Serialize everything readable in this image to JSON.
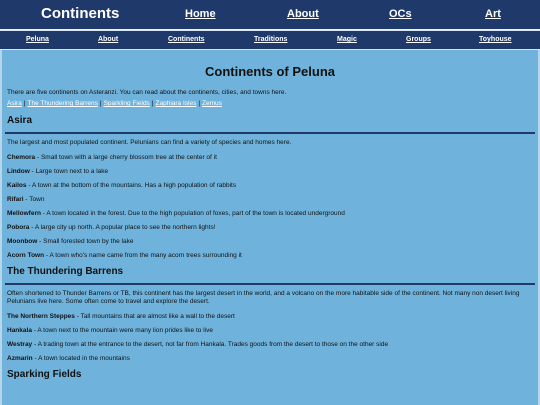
{
  "header": {
    "site_title": "Continents",
    "nav": [
      "Home",
      "About",
      "OCs",
      "Art"
    ]
  },
  "subnav": [
    "Peluna",
    "About",
    "Continents",
    "Traditions",
    "Magic",
    "Groups",
    "Toyhouse"
  ],
  "page": {
    "title": "Continents of Peluna",
    "intro": "There are five continents on Asteranzi. You can read about the continents, cities, and towns here.",
    "quicklinks": [
      "Asira",
      "The Thundering Barrens",
      "Sparkling Fields",
      "Zaphiara Isles",
      "Zemus"
    ]
  },
  "sections": [
    {
      "title": "Asira",
      "description": "The largest and most populated continent. Pelunians can find a variety of species and homes here.",
      "towns": [
        {
          "name": "Chemora",
          "text": " - Small town with a large cherry blossom tree at the center of it"
        },
        {
          "name": "Lindow",
          "text": " - Large town next to a lake"
        },
        {
          "name": "Kailos",
          "text": " - A town at the bottom of the mountains. Has a high population of rabbits"
        },
        {
          "name": "Rifari",
          "text": " - Town"
        },
        {
          "name": "Mellowfern",
          "text": " - A town located in the forest. Due to the high population of foxes, part of the town is located underground"
        },
        {
          "name": "Pobora",
          "text": " - A large city up north. A popular place to see the northern lights!"
        },
        {
          "name": "Moonbow",
          "text": " - Small forested town by the lake"
        },
        {
          "name": "Acorn Town",
          "text": " - A town who's name came from the many acorn trees surrounding it"
        }
      ]
    },
    {
      "title": "The Thundering Barrens",
      "description": "Often shortened to Thunder Barrens or TB, this continent has the largest desert in the world, and a volcano on the more habitable side of the continent. Not many non desert living Pelunians live here. Some often come to travel and explore the desert.",
      "towns": [
        {
          "name": "The Northern Steppes",
          "text": " - Tall mountains that are almost like a wall to the desert"
        },
        {
          "name": "Hankala",
          "text": " - A town next to the mountain were many lion prides like to live"
        },
        {
          "name": "Westray",
          "text": " - A trading town at the entrance to the desert, not far from Hankala. Trades goods from the desert to those on the other side"
        },
        {
          "name": "Azmarin",
          "text": " - A town located in the mountains"
        }
      ]
    },
    {
      "title": "Sparking Fields",
      "description": "",
      "towns": []
    }
  ]
}
